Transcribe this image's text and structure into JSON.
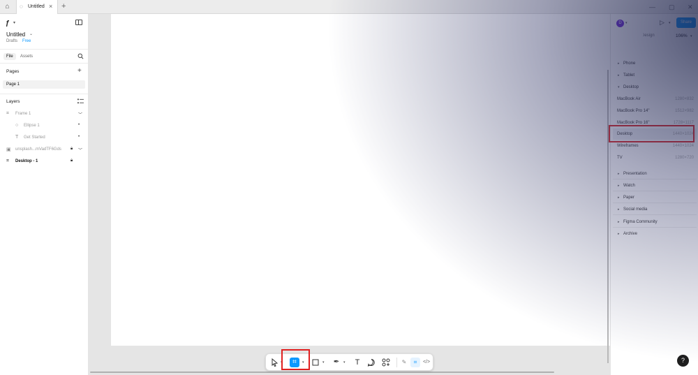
{
  "tabbar": {
    "tab_label": "Untitled",
    "close_glyph": "×",
    "plus_glyph": "+"
  },
  "left_panel": {
    "file_title": "Untitled",
    "location": "Drafts",
    "plan": "Free",
    "tabs": {
      "file": "File",
      "assets": "Assets"
    },
    "pages_title": "Pages",
    "pages": [
      "Page 1"
    ],
    "layers_title": "Layers",
    "layers": [
      {
        "name": "Frame 1",
        "icon": "frame-icon"
      },
      {
        "name": "Ellipse 1",
        "icon": "ellipse-icon"
      },
      {
        "name": "Get Started",
        "icon": "text-icon"
      },
      {
        "name": "unsplash...mVadTF6Gds",
        "icon": "image-icon"
      },
      {
        "name": "Desktop - 1",
        "icon": "frame-icon"
      }
    ]
  },
  "right_panel": {
    "avatar_letter": "D",
    "share_label": "Share",
    "design_label": "Design",
    "zoom": "106%",
    "categories_top": [
      {
        "label": "Phone"
      },
      {
        "label": "Tablet"
      },
      {
        "label": "Desktop"
      }
    ],
    "presets": [
      {
        "name": "MacBook Air",
        "size": "1280×832"
      },
      {
        "name": "MacBook Pro 14\"",
        "size": "1512×982"
      },
      {
        "name": "MacBook Pro 16\"",
        "size": "1728×1117"
      },
      {
        "name": "Desktop",
        "size": "1440×1024"
      },
      {
        "name": "Wireframes",
        "size": "1440×1024"
      },
      {
        "name": "TV",
        "size": "1280×720"
      }
    ],
    "categories_bottom": [
      {
        "label": "Presentation"
      },
      {
        "label": "Watch"
      },
      {
        "label": "Paper"
      },
      {
        "label": "Social media"
      },
      {
        "label": "Figma Community"
      },
      {
        "label": "Archive"
      }
    ]
  },
  "toolbar": {
    "tools": [
      "move-tool",
      "frame-tool",
      "shape-tool",
      "pen-tool",
      "text-tool",
      "comment-tool",
      "actions-tool",
      "draw-mode",
      "design-mode",
      "dev-mode"
    ],
    "text_glyph": "T"
  },
  "help_label": "?",
  "colors": {
    "accent": "#0d99ff",
    "highlight": "#e02020",
    "avatar": "#6d28d9"
  }
}
